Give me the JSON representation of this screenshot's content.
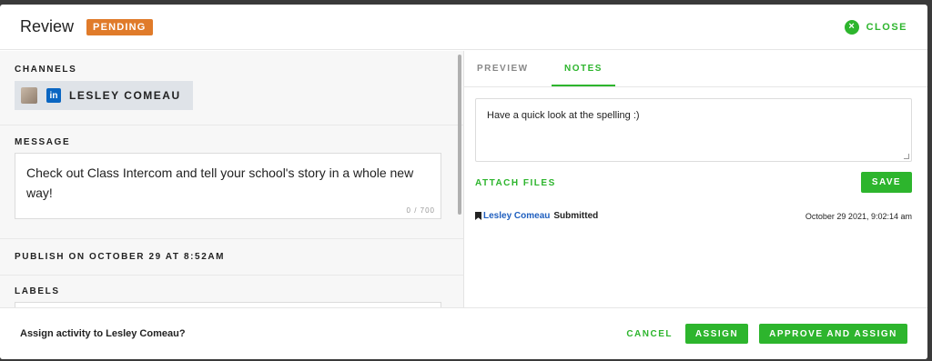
{
  "header": {
    "title": "Review",
    "status": "PENDING",
    "close_icon": "×",
    "close_label": "CLOSE"
  },
  "left": {
    "channels_label": "CHANNELS",
    "channel": {
      "network": "linkedin",
      "network_icon": "in",
      "name": "LESLEY COMEAU"
    },
    "message_label": "MESSAGE",
    "message_text": "Check out Class Intercom and tell your school's story in a whole new way!",
    "char_count": "0 / 700",
    "publish_label": "PUBLISH ON OCTOBER 29 AT 8:52AM",
    "labels_label": "LABELS"
  },
  "right": {
    "tabs": [
      {
        "label": "PREVIEW",
        "active": false
      },
      {
        "label": "NOTES",
        "active": true
      }
    ],
    "note_text": "Have a quick look at the spelling :)",
    "attach_label": "ATTACH FILES",
    "save_label": "SAVE",
    "activity": {
      "user": "Lesley Comeau",
      "action": "Submitted",
      "time": "October 29 2021, 9:02:14 am"
    }
  },
  "footer": {
    "question": "Assign activity to Lesley Comeau?",
    "cancel_label": "CANCEL",
    "assign_label": "ASSIGN",
    "approve_label": "APPROVE AND ASSIGN"
  },
  "colors": {
    "accent": "#2db52d",
    "pending": "#e07b2a",
    "link": "#1f5fbf",
    "linkedin": "#0a66c2"
  }
}
